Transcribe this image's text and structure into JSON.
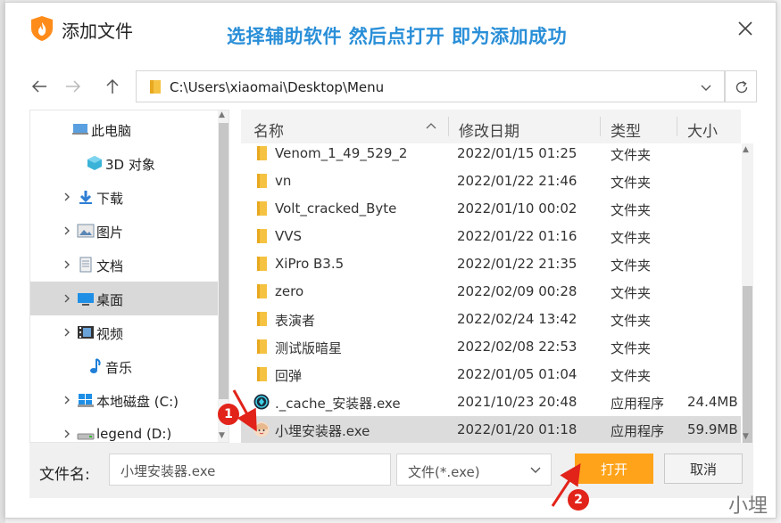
{
  "dialog": {
    "title": "添加文件",
    "hint": "选择辅助软件 然后点打开 即为添加成功"
  },
  "address": {
    "path": "C:\\Users\\xiaomai\\Desktop\\Menu"
  },
  "tree": {
    "items": [
      {
        "label": "此电脑",
        "icon": "computer-icon",
        "expandable": false
      },
      {
        "label": "3D 对象",
        "icon": "3d-objects-icon",
        "expandable": false
      },
      {
        "label": "下载",
        "icon": "download-icon",
        "expandable": true
      },
      {
        "label": "图片",
        "icon": "pictures-icon",
        "expandable": true
      },
      {
        "label": "文档",
        "icon": "documents-icon",
        "expandable": true
      },
      {
        "label": "桌面",
        "icon": "desktop-icon",
        "expandable": true,
        "selected": true
      },
      {
        "label": "视频",
        "icon": "videos-icon",
        "expandable": true
      },
      {
        "label": "音乐",
        "icon": "music-icon",
        "expandable": false
      },
      {
        "label": "本地磁盘 (C:)",
        "icon": "local-disk-icon",
        "expandable": true
      },
      {
        "label": "legend (D:)",
        "icon": "drive-icon",
        "expandable": true
      }
    ]
  },
  "columns": {
    "name": "名称",
    "date": "修改日期",
    "type": "类型",
    "size": "大小"
  },
  "files": [
    {
      "name": "Venom_1_49_529_2",
      "date": "2022/01/15 01:25",
      "type": "文件夹",
      "size": "",
      "icon": "folder-icon"
    },
    {
      "name": "vn",
      "date": "2022/01/22 21:46",
      "type": "文件夹",
      "size": "",
      "icon": "folder-icon"
    },
    {
      "name": "Volt_cracked_Byte",
      "date": "2022/01/10 00:02",
      "type": "文件夹",
      "size": "",
      "icon": "folder-icon"
    },
    {
      "name": "VVS",
      "date": "2022/01/22 01:16",
      "type": "文件夹",
      "size": "",
      "icon": "folder-icon"
    },
    {
      "name": "XiPro B3.5",
      "date": "2022/01/22 21:35",
      "type": "文件夹",
      "size": "",
      "icon": "folder-icon"
    },
    {
      "name": "zero",
      "date": "2022/02/09 00:28",
      "type": "文件夹",
      "size": "",
      "icon": "folder-icon"
    },
    {
      "name": "表演者",
      "date": "2022/02/24 13:42",
      "type": "文件夹",
      "size": "",
      "icon": "folder-icon"
    },
    {
      "name": "测试版暗星",
      "date": "2022/02/08 22:53",
      "type": "文件夹",
      "size": "",
      "icon": "folder-icon"
    },
    {
      "name": "回弹",
      "date": "2022/01/05 01:04",
      "type": "文件夹",
      "size": "",
      "icon": "folder-icon"
    },
    {
      "name": "._cache_安装器.exe",
      "date": "2021/10/23 20:48",
      "type": "应用程序",
      "size": "24.4MB",
      "icon": "exe-app-icon"
    },
    {
      "name": "小埋安装器.exe",
      "date": "2022/01/20 01:18",
      "type": "应用程序",
      "size": "59.9MB",
      "icon": "umaru-app-icon",
      "selected": true
    }
  ],
  "footer": {
    "filename_label": "文件名:",
    "filename_value": "小埋安装器.exe",
    "filetype": "文件(*.exe)",
    "open_label": "打开",
    "cancel_label": "取消"
  },
  "annotations": {
    "badge1": "1",
    "badge2": "2",
    "watermark": "小埋"
  },
  "colors": {
    "accent_orange": "#ffa31a",
    "hint_blue": "#2a8fd8",
    "annotation_red": "#e2231a",
    "selection_gray": "#dcdcdc"
  }
}
